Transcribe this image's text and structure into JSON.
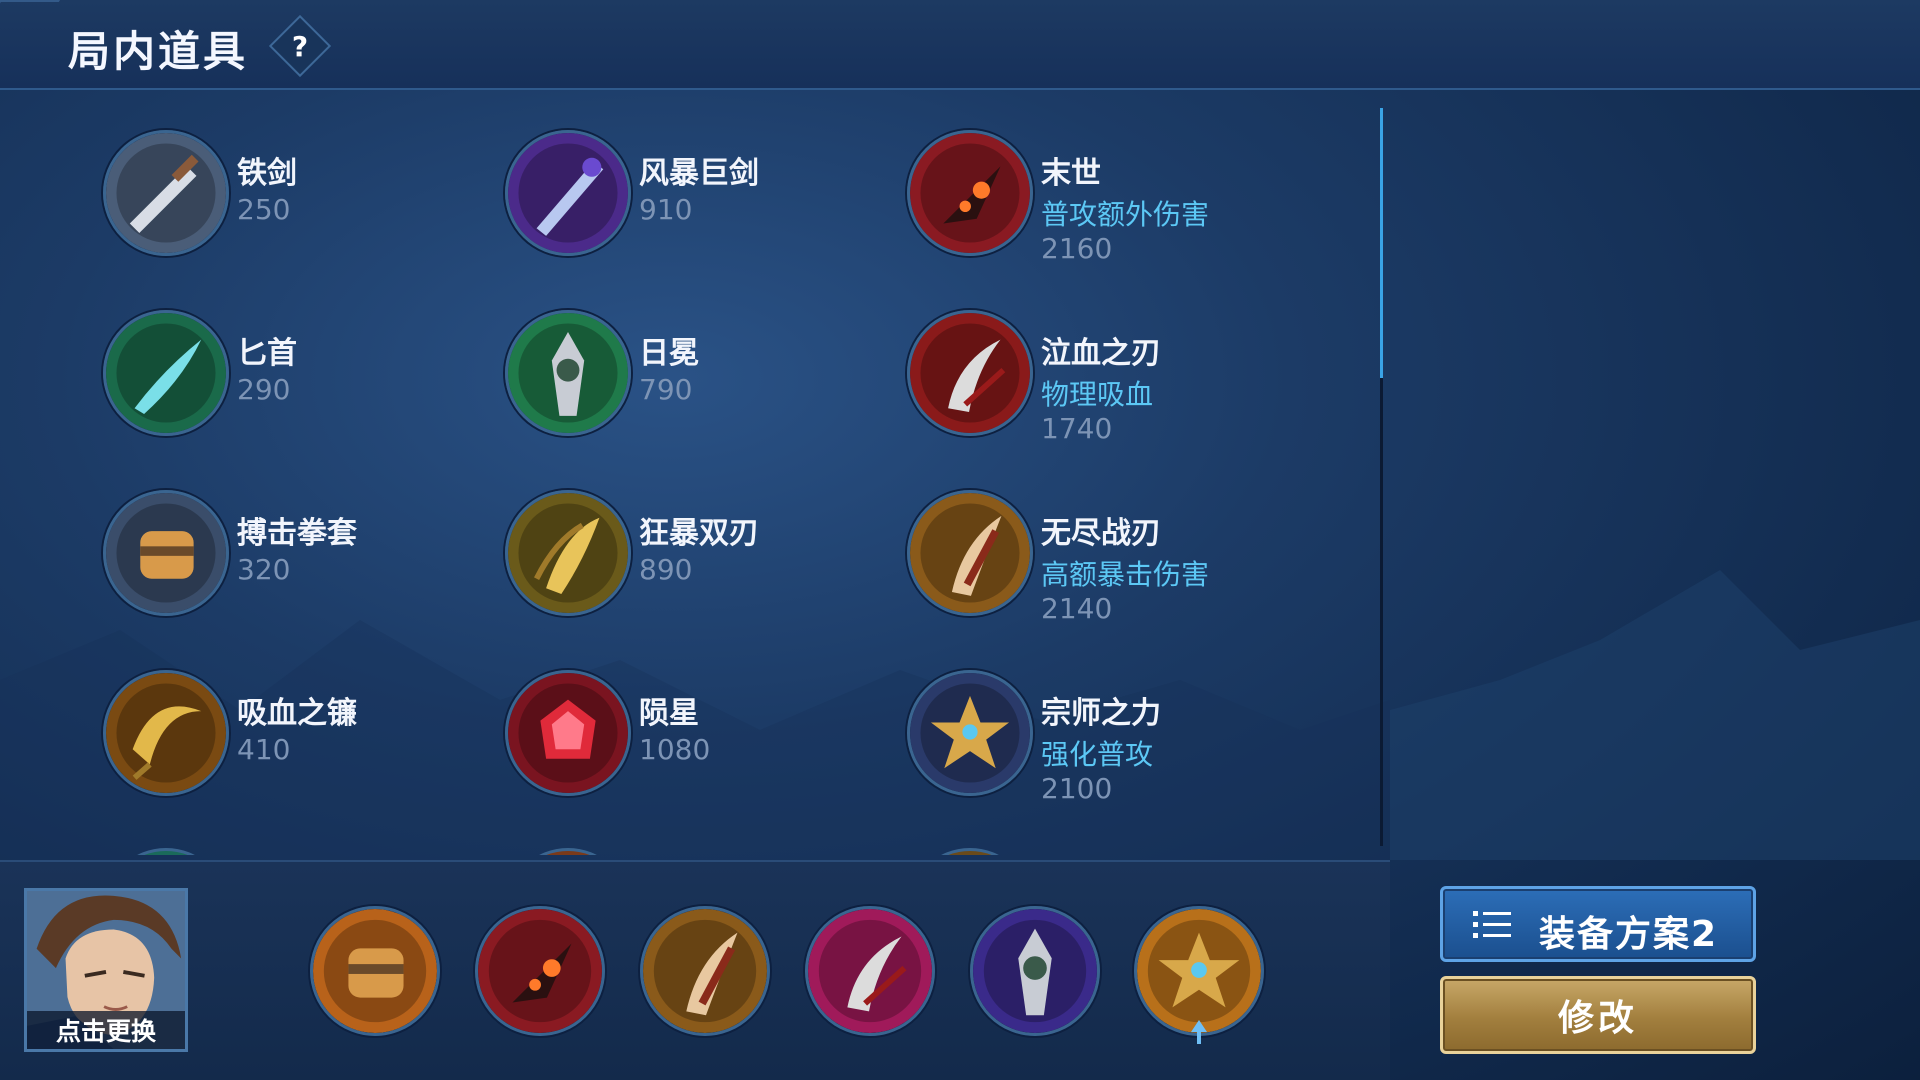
{
  "header": {
    "title": "局内道具",
    "help_label": "?"
  },
  "items": [
    {
      "name": "铁剑",
      "effect": "",
      "price": "250",
      "icon": "iron-sword-icon",
      "color": "#4a5d78"
    },
    {
      "name": "风暴巨剑",
      "effect": "",
      "price": "910",
      "icon": "storm-greatsword-icon",
      "color": "#4b2a8a"
    },
    {
      "name": "末世",
      "effect": "普攻额外伤害",
      "price": "2160",
      "icon": "doomsday-icon",
      "color": "#8a1a22"
    },
    {
      "name": "匕首",
      "effect": "",
      "price": "290",
      "icon": "dagger-icon",
      "color": "#1a6a4a"
    },
    {
      "name": "日冕",
      "effect": "",
      "price": "790",
      "icon": "corona-icon",
      "color": "#1f7a4a"
    },
    {
      "name": "泣血之刃",
      "effect": "物理吸血",
      "price": "1740",
      "icon": "bloodweeper-blade-icon",
      "color": "#8a1a1a"
    },
    {
      "name": "搏击拳套",
      "effect": "",
      "price": "320",
      "icon": "boxing-gauntlet-icon",
      "color": "#3a4d6a"
    },
    {
      "name": "狂暴双刃",
      "effect": "",
      "price": "890",
      "icon": "frenzy-dual-blades-icon",
      "color": "#6a5a1a"
    },
    {
      "name": "无尽战刃",
      "effect": "高额暴击伤害",
      "price": "2140",
      "icon": "endless-blade-icon",
      "color": "#8a5a1a"
    },
    {
      "name": "吸血之镰",
      "effect": "",
      "price": "410",
      "icon": "vampire-scythe-icon",
      "color": "#7a4a12"
    },
    {
      "name": "陨星",
      "effect": "",
      "price": "1080",
      "icon": "meteor-icon",
      "color": "#7a1420"
    },
    {
      "name": "宗师之力",
      "effect": "强化普攻",
      "price": "2100",
      "icon": "masters-might-icon",
      "color": "#2a3a6a"
    }
  ],
  "hero": {
    "caption": "点击更换"
  },
  "equipment_slots": [
    {
      "icon": "boots-icon",
      "color": "#b8621a"
    },
    {
      "icon": "doomsday-icon",
      "color": "#8a1a22"
    },
    {
      "icon": "endless-blade-icon",
      "color": "#8a5a1a"
    },
    {
      "icon": "pink-blade-icon",
      "color": "#a01a5a"
    },
    {
      "icon": "purple-armor-icon",
      "color": "#3a2a8a"
    },
    {
      "icon": "golden-ring-icon",
      "color": "#b8701a"
    }
  ],
  "plan_button": {
    "label": "装备方案2",
    "icon": "list-icon"
  },
  "modify_button": {
    "label": "修改"
  },
  "colors": {
    "accent_blue": "#5cc8f5",
    "price_gray": "#7d94b5",
    "gold_button": "#a27f3e",
    "plan_button": "#2c6eb8"
  }
}
